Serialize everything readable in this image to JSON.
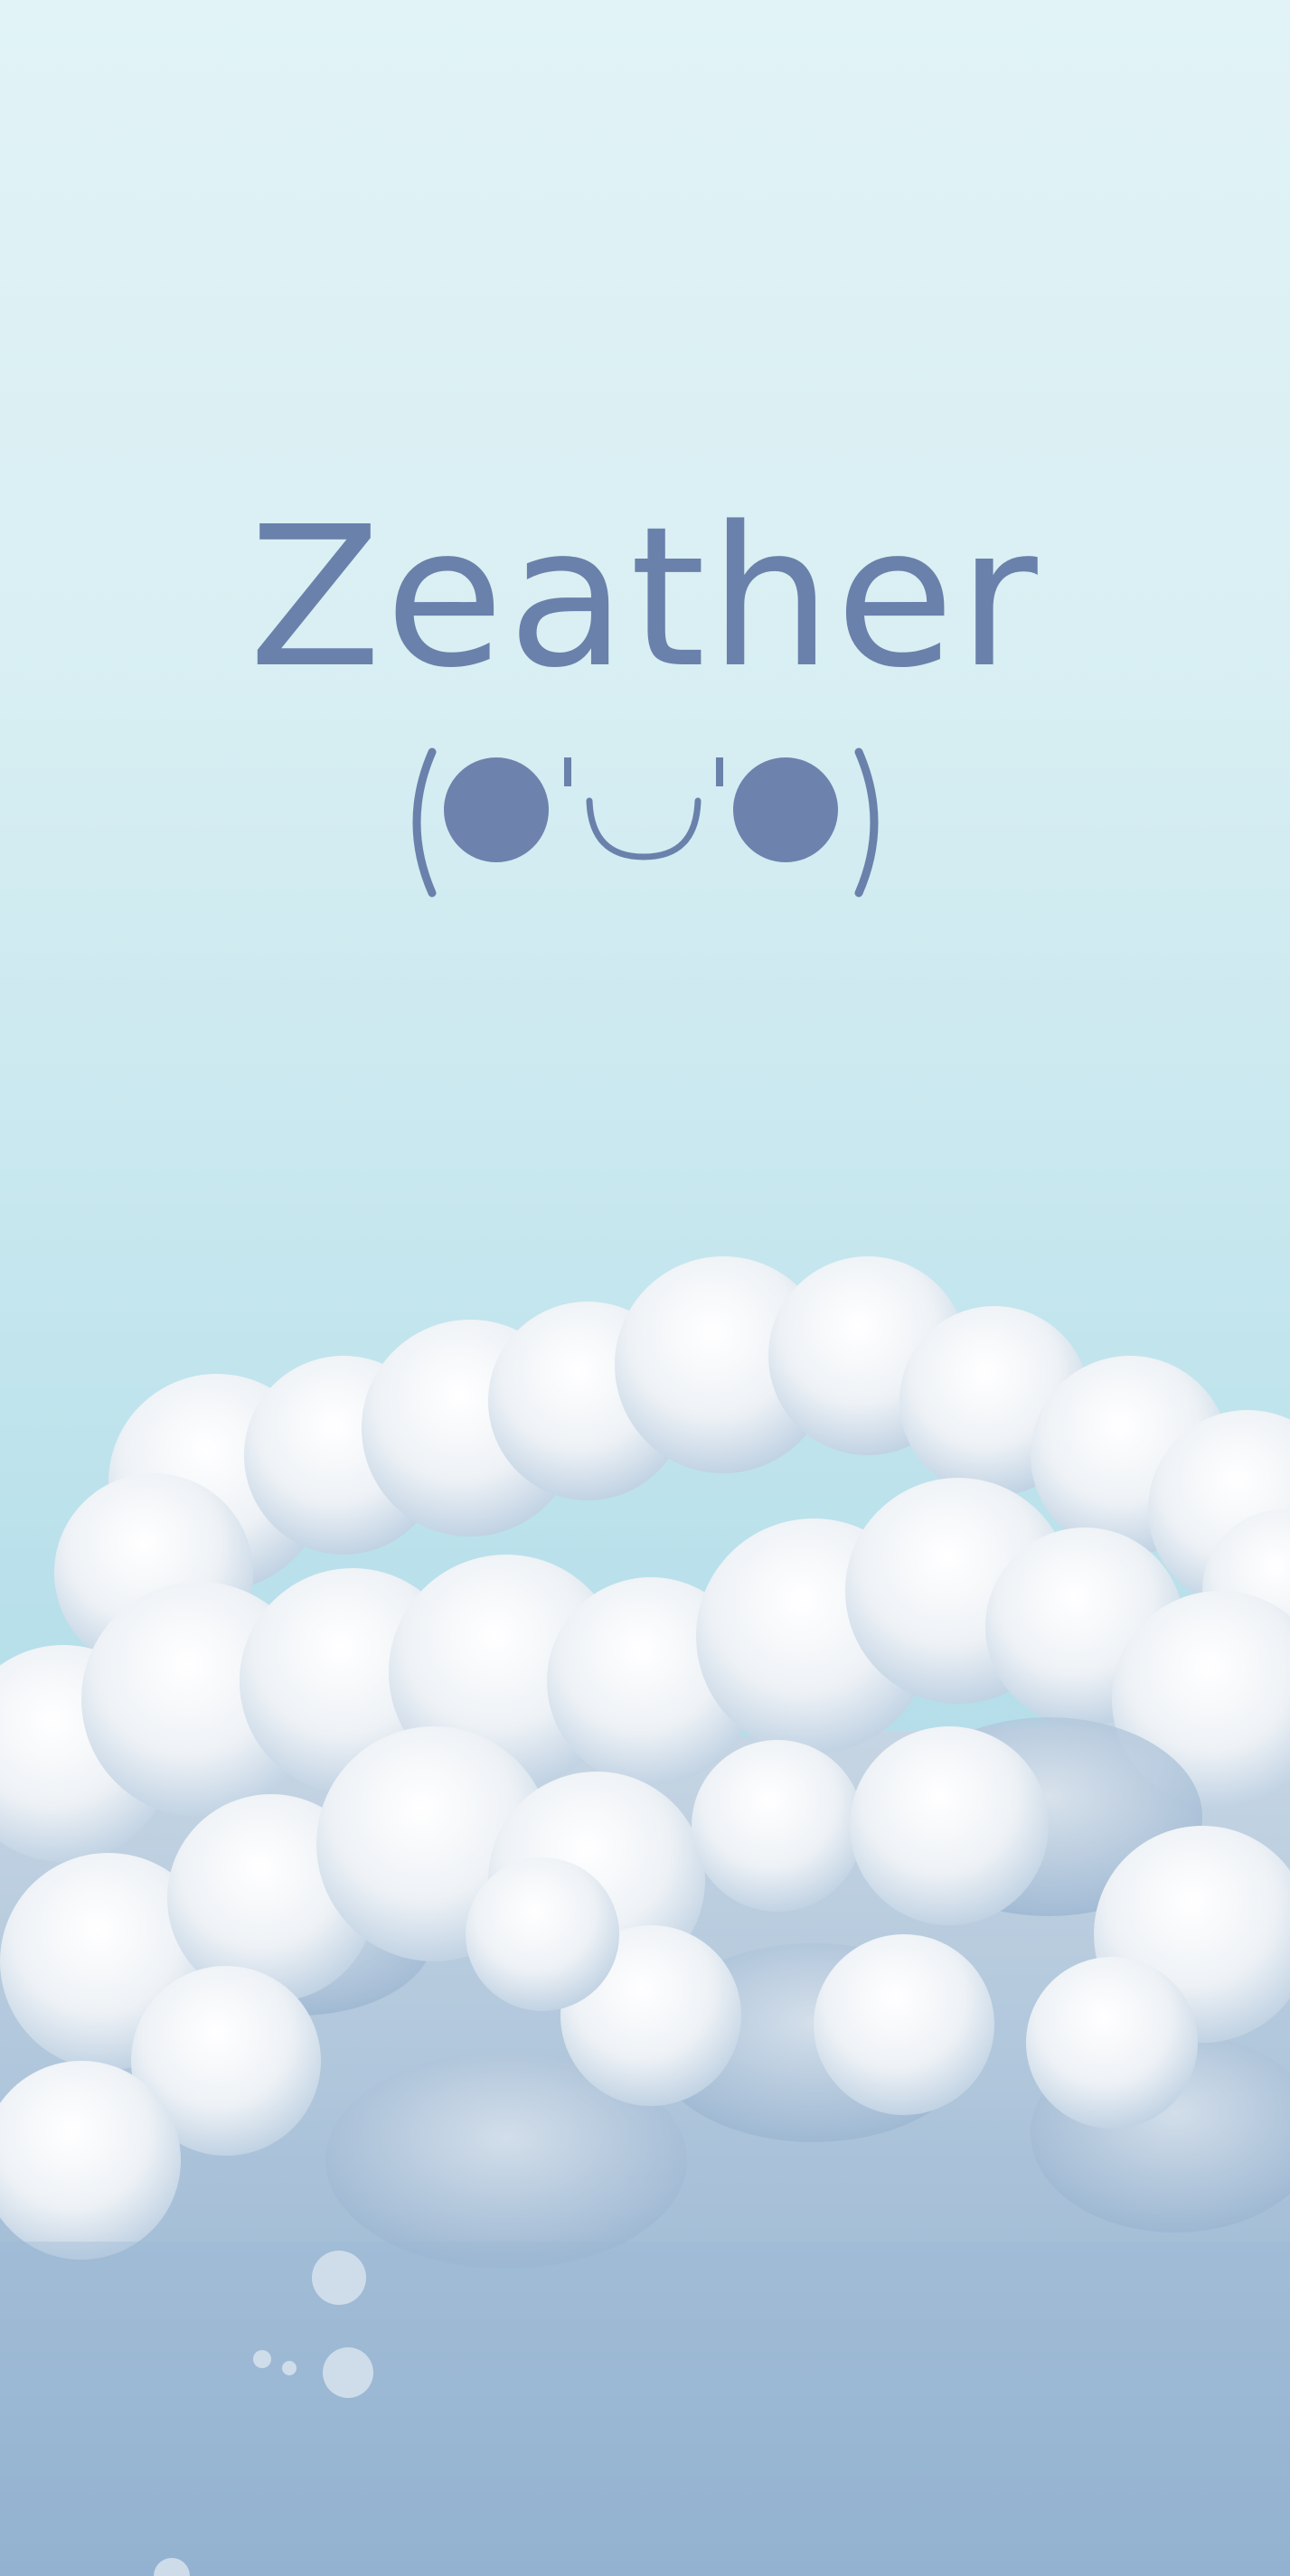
{
  "app": {
    "title": "Zeather",
    "mascot_face": "(●'◡'●)"
  },
  "colors": {
    "accent": "#6a81ab",
    "sky_top": "#e1f3f6",
    "sky_bottom": "#a9d6e6",
    "cloud_light": "#f7f8fa",
    "cloud_shadow": "#8fadcc"
  },
  "icons": {
    "mascot": "kaomoji-face-icon",
    "background": "cloud-illustration"
  }
}
